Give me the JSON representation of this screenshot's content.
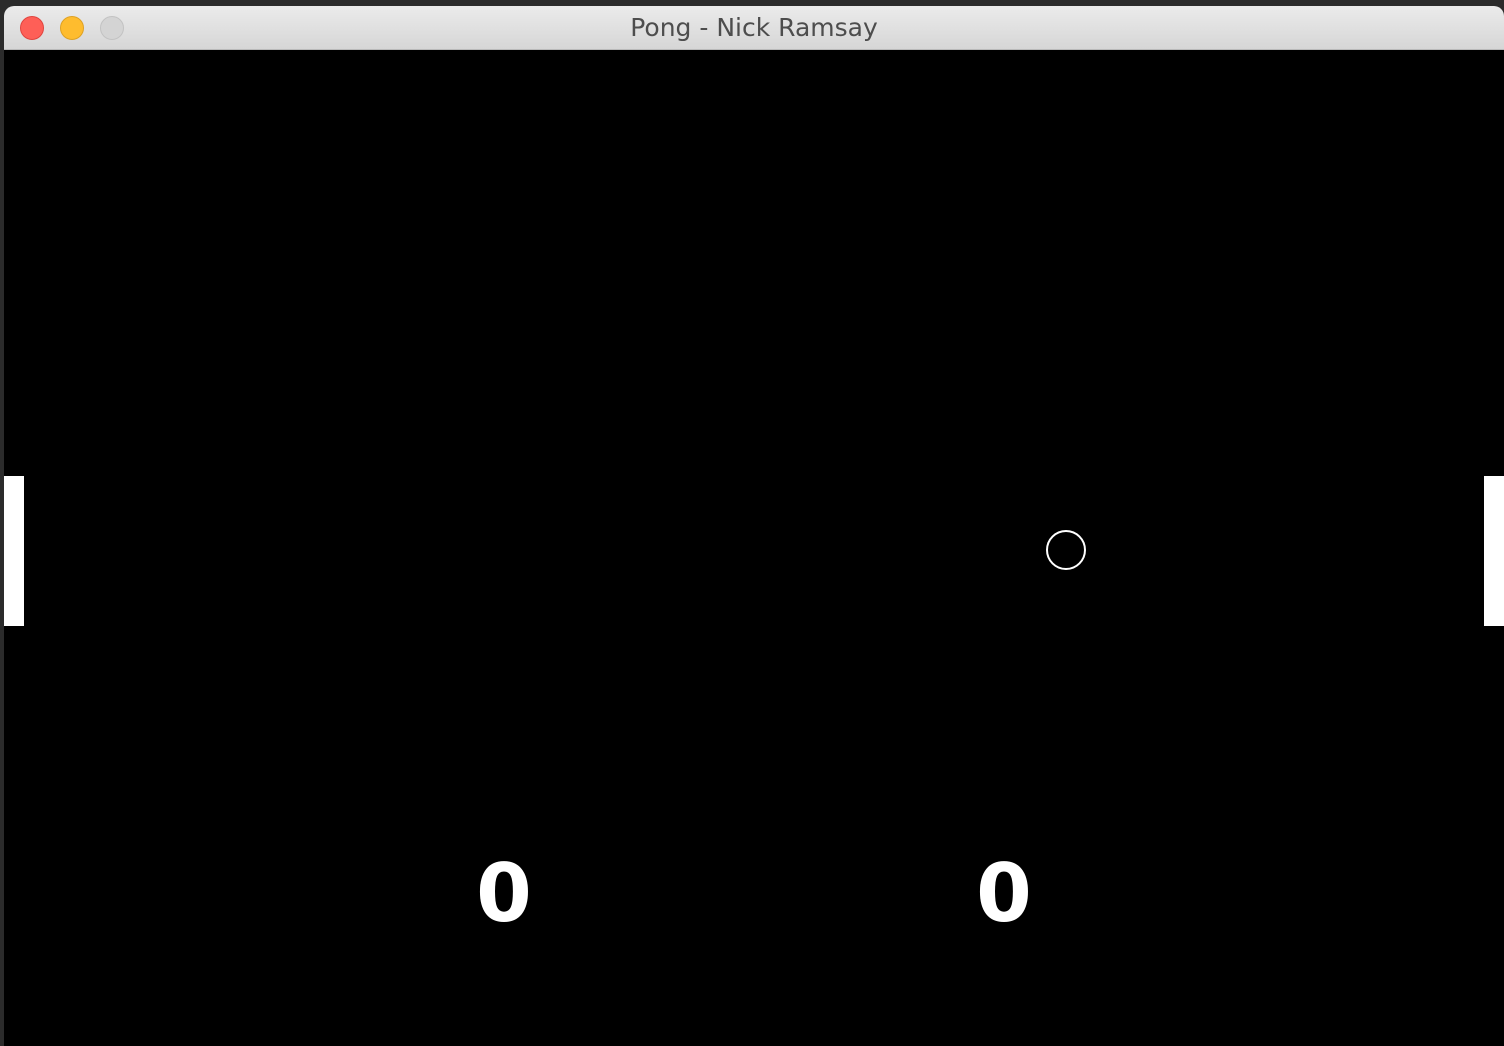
{
  "window": {
    "title": "Pong - Nick Ramsay"
  },
  "controls": {
    "close_icon": "close-icon",
    "minimize_icon": "minimize-icon",
    "zoom_icon": "zoom-icon"
  },
  "game": {
    "score_left": "0",
    "score_right": "0"
  },
  "colors": {
    "background": "#000000",
    "foreground": "#ffffff",
    "close": "#fe5f57",
    "minimize": "#febc2e",
    "zoom_disabled": "#d4d4d4"
  }
}
